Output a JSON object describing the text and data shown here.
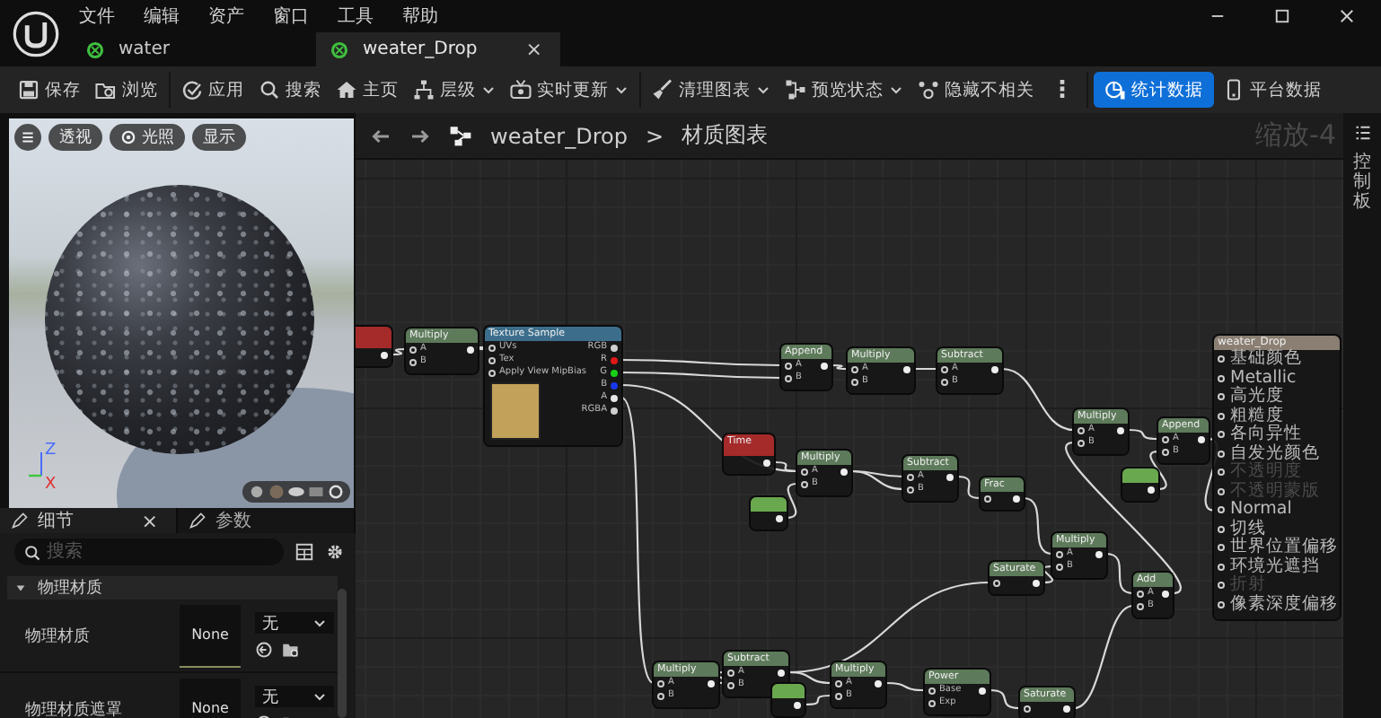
{
  "menu": [
    "文件",
    "编辑",
    "资产",
    "窗口",
    "工具",
    "帮助"
  ],
  "tabs": [
    {
      "label": "water",
      "selected": false
    },
    {
      "label": "weater_Drop",
      "selected": true,
      "close": "×"
    }
  ],
  "toolbar": [
    [
      {
        "label": "保存",
        "dropdown": false,
        "on": false
      },
      {
        "label": "浏览",
        "dropdown": false,
        "on": false
      }
    ],
    [
      {
        "label": "应用",
        "dropdown": false,
        "on": false
      },
      {
        "label": "搜索",
        "dropdown": false,
        "on": false
      },
      {
        "label": "主页",
        "dropdown": false,
        "on": false
      },
      {
        "label": "层级",
        "dropdown": true,
        "on": false
      },
      {
        "label": "实时更新",
        "dropdown": true,
        "on": false
      }
    ],
    [
      {
        "label": "清理图表",
        "dropdown": true,
        "on": false
      },
      {
        "label": "预览状态",
        "dropdown": true,
        "on": false
      },
      {
        "label": "隐藏不相关",
        "dropdown": false,
        "on": false
      },
      {
        "kind": "more",
        "label": "⋮",
        "dropdown": false,
        "on": false
      }
    ],
    [
      {
        "label": "统计数据",
        "dropdown": false,
        "on": true
      },
      {
        "label": "平台数据",
        "dropdown": false,
        "on": false
      }
    ]
  ],
  "viewport": {
    "buttons": [
      "透视",
      "光照",
      "显示"
    ],
    "axes": [
      "Z",
      "X"
    ]
  },
  "details": {
    "tabs": [
      {
        "label": "细节",
        "selected": true,
        "close": "×"
      },
      {
        "label": "参数",
        "selected": false
      }
    ],
    "search": {
      "placeholder": "搜索"
    },
    "section": {
      "title": "物理材质",
      "expanded": true,
      "rows": [
        {
          "label": "物理材质",
          "thumb": "None",
          "value": "无"
        },
        {
          "label": "物理材质遮罩",
          "thumb": "None",
          "value": "无"
        }
      ]
    }
  },
  "graph": {
    "breadcrumb": [
      "weater_Drop",
      "材质图表"
    ],
    "separator": ">",
    "zoom": "缩放-4",
    "side_panel": "控制板",
    "nodes": [
      {
        "kind": "param"
      },
      {
        "kind": "math",
        "title": "Multiply",
        "inputs": [
          "A",
          "B"
        ]
      },
      {
        "kind": "texture",
        "title": "Texture Sample",
        "inputs": [
          "UVs",
          "Tex",
          "Apply View MipBias"
        ],
        "outputs": [
          {
            "label": "RGB",
            "color": "#cfcfcf"
          },
          {
            "label": "R",
            "color": "#e01818"
          },
          {
            "label": "G",
            "color": "#18d018"
          },
          {
            "label": "B",
            "color": "#1838f0"
          },
          {
            "label": "A",
            "color": "#e6e6e6"
          },
          {
            "label": "RGBA",
            "color": "#cfcfcf"
          }
        ]
      },
      {
        "kind": "math",
        "title": "Append",
        "inputs": [
          "A",
          "B"
        ]
      },
      {
        "kind": "math",
        "title": "Multiply",
        "inputs": [
          "A",
          "B"
        ]
      },
      {
        "kind": "math",
        "title": "Subtract",
        "inputs": [
          "A",
          "B"
        ]
      },
      {
        "kind": "param",
        "title": "Time"
      },
      {
        "kind": "math",
        "title": "Multiply",
        "inputs": [
          "A",
          "B"
        ]
      },
      {
        "kind": "constant"
      },
      {
        "kind": "math",
        "title": "Subtract",
        "inputs": [
          "A",
          "B"
        ]
      },
      {
        "kind": "unary",
        "title": "Frac"
      },
      {
        "kind": "math",
        "title": "Multiply",
        "inputs": [
          "A",
          "B"
        ]
      },
      {
        "kind": "math",
        "title": "Append",
        "inputs": [
          "A",
          "B"
        ]
      },
      {
        "kind": "constant"
      },
      {
        "kind": "result",
        "title": "weater_Drop",
        "inputs": [
          {
            "label": "基础颜色",
            "enabled": true
          },
          {
            "label": "Metallic",
            "enabled": true
          },
          {
            "label": "高光度",
            "enabled": true
          },
          {
            "label": "粗糙度",
            "enabled": true
          },
          {
            "label": "各向异性",
            "enabled": true
          },
          {
            "label": "自发光颜色",
            "enabled": true
          },
          {
            "label": "不透明度",
            "enabled": false
          },
          {
            "label": "不透明蒙版",
            "enabled": false
          },
          {
            "label": "Normal",
            "enabled": true
          },
          {
            "label": "切线",
            "enabled": true
          },
          {
            "label": "世界位置偏移",
            "enabled": true
          },
          {
            "label": "环境光遮挡",
            "enabled": true
          },
          {
            "label": "折射",
            "enabled": false
          },
          {
            "label": "像素深度偏移",
            "enabled": true
          }
        ]
      },
      {
        "kind": "math",
        "title": "Multiply",
        "inputs": [
          "A",
          "B"
        ]
      },
      {
        "kind": "unary",
        "title": "Saturate"
      },
      {
        "kind": "math",
        "title": "Add",
        "inputs": [
          "A",
          "B"
        ]
      },
      {
        "kind": "math",
        "title": "Multiply",
        "inputs": [
          "A",
          "B"
        ]
      },
      {
        "kind": "math",
        "title": "Subtract",
        "inputs": [
          "A",
          "B"
        ]
      },
      {
        "kind": "constant"
      },
      {
        "kind": "math",
        "title": "Multiply",
        "inputs": [
          "A",
          "B"
        ]
      },
      {
        "kind": "math",
        "title": "Power",
        "inputs": [
          "Base",
          "Exp"
        ]
      },
      {
        "kind": "unary",
        "title": "Saturate"
      }
    ]
  }
}
